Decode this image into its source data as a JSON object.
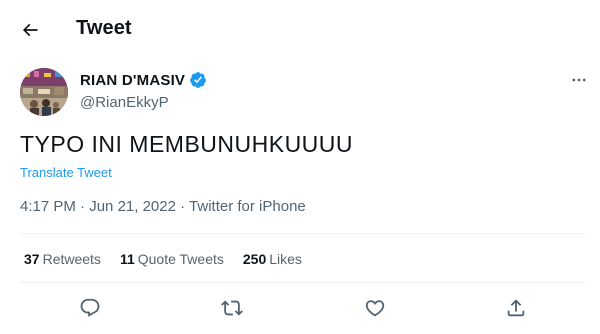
{
  "header": {
    "title": "Tweet"
  },
  "author": {
    "display_name": "RIAN D'MASIV",
    "handle": "@RianEkkyP",
    "verified": true
  },
  "tweet": {
    "text": "TYPO INI MEMBUNUHKUUUU",
    "translate_label": "Translate Tweet",
    "time": "4:17 PM",
    "date": "Jun 21, 2022",
    "source": "Twitter for iPhone",
    "separator": " · "
  },
  "stats": [
    {
      "count": "37",
      "label": "Retweets"
    },
    {
      "count": "11",
      "label": "Quote Tweets"
    },
    {
      "count": "250",
      "label": "Likes"
    }
  ],
  "actions": [
    "reply-icon",
    "retweet-icon",
    "like-icon",
    "share-icon"
  ],
  "colors": {
    "accent": "#1d9bf0",
    "secondary_text": "#536471",
    "primary_text": "#0f1419",
    "divider": "#eff3f4"
  }
}
